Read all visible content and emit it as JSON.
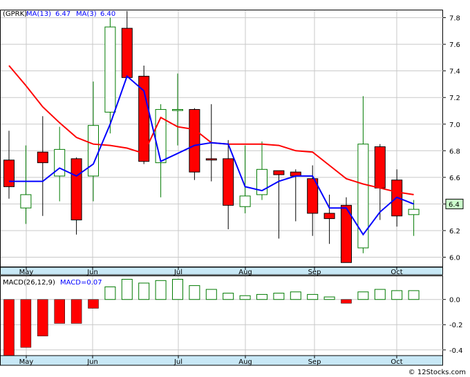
{
  "header": {
    "symbol": "(GPRK)",
    "ma13_label": "MA(13)",
    "ma13_value": "6.47",
    "ma3_label": "MA(3)",
    "ma3_value": "6.40",
    "macd_label": "MACD(26,12,9)",
    "macd_value_label": "MACD=0.07",
    "last_price_tag": "6.4"
  },
  "credit": "© 12Stocks.com",
  "colors": {
    "up": "#007a00",
    "down": "#ff0000",
    "ma13": "#ff0000",
    "ma3": "#0000ff",
    "axis_band": "#c8e8f6",
    "grid": "#c8c8c8",
    "price_tag_bg": "#ccffcc"
  },
  "chart_data": [
    {
      "type": "candlestick",
      "title": "(GPRK)",
      "months": [
        "May",
        "Jun",
        "Jul",
        "Aug",
        "Sep",
        "Oct"
      ],
      "y_ticks": [
        6.0,
        6.2,
        6.4,
        6.6,
        6.8,
        7.0,
        7.2,
        7.4,
        7.6,
        7.8
      ],
      "ylim": [
        5.93,
        7.86
      ],
      "grid": true,
      "candles": [
        {
          "o": 6.73,
          "h": 6.95,
          "l": 6.44,
          "c": 6.53
        },
        {
          "o": 6.37,
          "h": 6.84,
          "l": 6.25,
          "c": 6.47
        },
        {
          "o": 6.79,
          "h": 7.06,
          "l": 6.31,
          "c": 6.71
        },
        {
          "o": 6.61,
          "h": 6.98,
          "l": 6.42,
          "c": 6.81
        },
        {
          "o": 6.74,
          "h": 6.75,
          "l": 6.17,
          "c": 6.28
        },
        {
          "o": 6.61,
          "h": 7.32,
          "l": 6.42,
          "c": 6.99
        },
        {
          "o": 7.09,
          "h": 7.8,
          "l": 6.93,
          "c": 7.73
        },
        {
          "o": 7.72,
          "h": 7.85,
          "l": 7.38,
          "c": 7.35
        },
        {
          "o": 7.36,
          "h": 7.44,
          "l": 6.7,
          "c": 6.72
        },
        {
          "o": 6.71,
          "h": 7.15,
          "l": 6.45,
          "c": 7.11
        },
        {
          "o": 7.11,
          "h": 7.38,
          "l": 6.84,
          "c": 7.11
        },
        {
          "o": 7.11,
          "h": 7.12,
          "l": 6.58,
          "c": 6.64
        },
        {
          "o": 6.74,
          "h": 7.15,
          "l": 6.57,
          "c": 6.73
        },
        {
          "o": 6.74,
          "h": 6.88,
          "l": 6.21,
          "c": 6.39
        },
        {
          "o": 6.38,
          "h": 6.84,
          "l": 6.33,
          "c": 6.46
        },
        {
          "o": 6.47,
          "h": 6.87,
          "l": 6.43,
          "c": 6.66
        },
        {
          "o": 6.65,
          "h": 6.64,
          "l": 6.14,
          "c": 6.62
        },
        {
          "o": 6.64,
          "h": 6.66,
          "l": 6.27,
          "c": 6.61
        },
        {
          "o": 6.59,
          "h": 6.69,
          "l": 6.16,
          "c": 6.33
        },
        {
          "o": 6.33,
          "h": 6.47,
          "l": 6.1,
          "c": 6.29
        },
        {
          "o": 6.39,
          "h": 6.45,
          "l": 5.96,
          "c": 5.96
        },
        {
          "o": 6.07,
          "h": 7.21,
          "l": 6.03,
          "c": 6.85
        },
        {
          "o": 6.83,
          "h": 6.85,
          "l": 6.28,
          "c": 6.52
        },
        {
          "o": 6.58,
          "h": 6.66,
          "l": 6.23,
          "c": 6.31
        },
        {
          "o": 6.32,
          "h": 6.43,
          "l": 6.16,
          "c": 6.36
        }
      ],
      "series": [
        {
          "name": "MA(13)",
          "values": [
            7.44,
            7.29,
            7.13,
            7.01,
            6.9,
            6.85,
            6.84,
            6.82,
            6.78,
            7.05,
            6.98,
            6.96,
            6.86,
            6.85,
            6.85,
            6.85,
            6.84,
            6.8,
            6.79,
            6.69,
            6.59,
            6.55,
            6.52,
            6.49,
            6.47
          ]
        },
        {
          "name": "MA(3)",
          "values": [
            6.57,
            6.57,
            6.57,
            6.67,
            6.61,
            6.7,
            7.0,
            7.36,
            7.25,
            6.72,
            6.78,
            6.84,
            6.86,
            6.85,
            6.53,
            6.5,
            6.57,
            6.61,
            6.61,
            6.37,
            6.37,
            6.17,
            6.34,
            6.45,
            6.4
          ]
        }
      ]
    },
    {
      "type": "bar",
      "title": "MACD(26,12,9)",
      "months": [
        "May",
        "Jun",
        "Jul",
        "Aug",
        "Sep",
        "Oct"
      ],
      "y_ticks": [
        0.0,
        -0.2,
        -0.4
      ],
      "ylim": [
        -0.445,
        0.19
      ],
      "values": [
        -0.45,
        -0.38,
        -0.29,
        -0.19,
        -0.19,
        -0.07,
        0.1,
        0.16,
        0.13,
        0.15,
        0.16,
        0.11,
        0.08,
        0.05,
        0.03,
        0.04,
        0.05,
        0.06,
        0.04,
        0.02,
        -0.03,
        0.06,
        0.08,
        0.07,
        0.07
      ]
    }
  ]
}
